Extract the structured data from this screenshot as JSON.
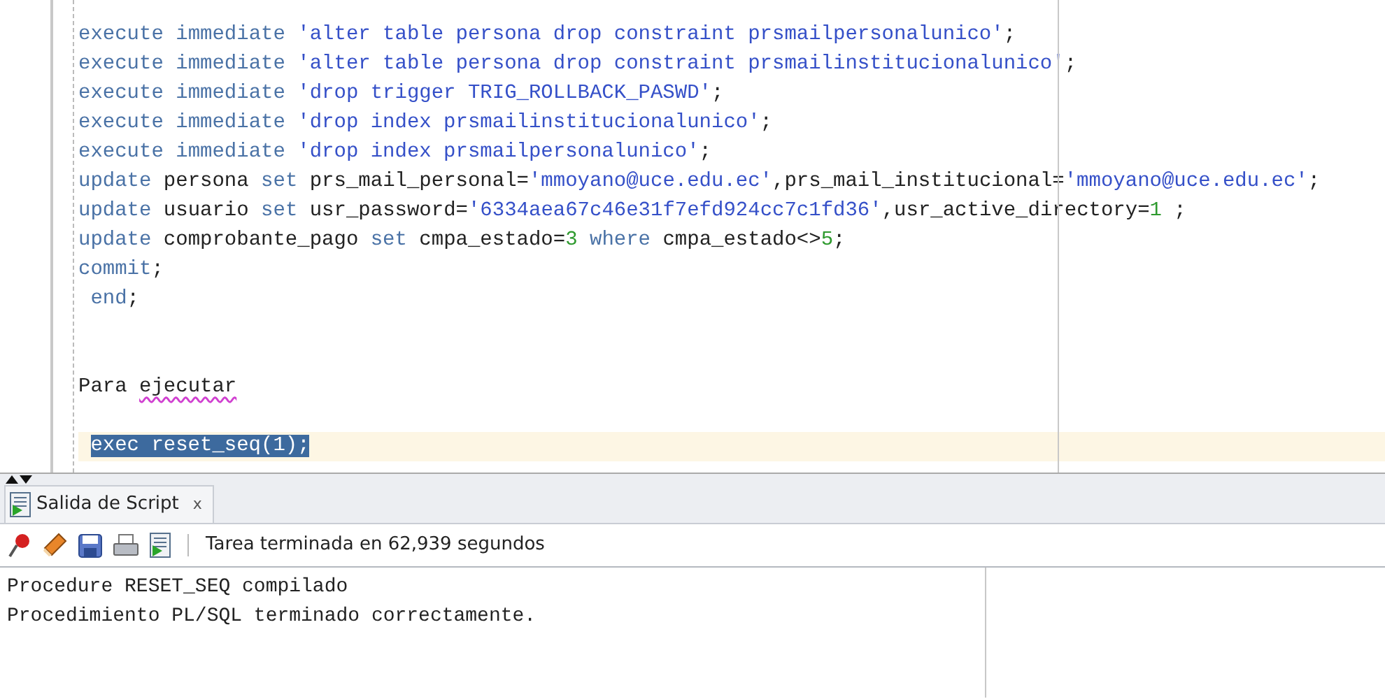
{
  "editor": {
    "lines": [
      {
        "current": false,
        "indent": false,
        "tokens": [
          {
            "text": "execute immediate ",
            "kind": "kw"
          },
          {
            "text": "'alter table persona drop constraint prsmailpersonalunico'",
            "kind": "str"
          },
          {
            "text": ";",
            "kind": "plain"
          }
        ]
      },
      {
        "current": false,
        "indent": false,
        "tokens": [
          {
            "text": "execute immediate ",
            "kind": "kw"
          },
          {
            "text": "'alter table persona drop constraint prsmailinstitucionalunico'",
            "kind": "str"
          },
          {
            "text": ";",
            "kind": "plain"
          }
        ]
      },
      {
        "current": false,
        "indent": false,
        "tokens": [
          {
            "text": "execute immediate ",
            "kind": "kw"
          },
          {
            "text": "'drop trigger TRIG_ROLLBACK_PASWD'",
            "kind": "str"
          },
          {
            "text": ";",
            "kind": "plain"
          }
        ]
      },
      {
        "current": false,
        "indent": false,
        "tokens": [
          {
            "text": "execute immediate ",
            "kind": "kw"
          },
          {
            "text": "'drop index prsmailinstitucionalunico'",
            "kind": "str"
          },
          {
            "text": ";",
            "kind": "plain"
          }
        ]
      },
      {
        "current": false,
        "indent": false,
        "tokens": [
          {
            "text": "execute immediate ",
            "kind": "kw"
          },
          {
            "text": "'drop index prsmailpersonalunico'",
            "kind": "str"
          },
          {
            "text": ";",
            "kind": "plain"
          }
        ]
      },
      {
        "current": false,
        "indent": false,
        "tokens": [
          {
            "text": "update",
            "kind": "kw"
          },
          {
            "text": " persona ",
            "kind": "plain"
          },
          {
            "text": "set",
            "kind": "kw"
          },
          {
            "text": " prs_mail_personal=",
            "kind": "plain"
          },
          {
            "text": "'mmoyano@uce.edu.ec'",
            "kind": "str"
          },
          {
            "text": ",prs_mail_institucional=",
            "kind": "plain"
          },
          {
            "text": "'mmoyano@uce.edu.ec'",
            "kind": "str"
          },
          {
            "text": ";",
            "kind": "plain"
          }
        ]
      },
      {
        "current": false,
        "indent": false,
        "tokens": [
          {
            "text": "update",
            "kind": "kw"
          },
          {
            "text": " usuario ",
            "kind": "plain"
          },
          {
            "text": "set",
            "kind": "kw"
          },
          {
            "text": " usr_password=",
            "kind": "plain"
          },
          {
            "text": "'6334aea67c46e31f7efd924cc7c1fd36'",
            "kind": "str"
          },
          {
            "text": ",usr_active_directory=",
            "kind": "plain"
          },
          {
            "text": "1",
            "kind": "num"
          },
          {
            "text": " ;",
            "kind": "plain"
          }
        ]
      },
      {
        "current": false,
        "indent": false,
        "tokens": [
          {
            "text": "update",
            "kind": "kw"
          },
          {
            "text": " comprobante_pago ",
            "kind": "plain"
          },
          {
            "text": "set",
            "kind": "kw"
          },
          {
            "text": " cmpa_estado=",
            "kind": "plain"
          },
          {
            "text": "3",
            "kind": "num"
          },
          {
            "text": " where",
            "kind": "kw"
          },
          {
            "text": " cmpa_estado<>",
            "kind": "plain"
          },
          {
            "text": "5",
            "kind": "num"
          },
          {
            "text": ";",
            "kind": "plain"
          }
        ]
      },
      {
        "current": false,
        "indent": false,
        "tokens": [
          {
            "text": "commit",
            "kind": "kw"
          },
          {
            "text": ";",
            "kind": "plain"
          }
        ]
      },
      {
        "current": false,
        "indent": true,
        "tokens": [
          {
            "text": "end",
            "kind": "kw"
          },
          {
            "text": ";",
            "kind": "plain"
          }
        ]
      },
      {
        "current": false,
        "indent": false,
        "tokens": [
          {
            "text": "Para ",
            "kind": "plain"
          },
          {
            "text": "ejecutar",
            "kind": "misspelled"
          }
        ]
      },
      {
        "current": true,
        "indent": true,
        "tokens": [
          {
            "text": "exec reset_seq(1);",
            "kind": "selection"
          }
        ]
      }
    ]
  },
  "output_panel": {
    "tabs": [
      {
        "label": "Salida de Script",
        "close": "x",
        "selected": true
      }
    ],
    "status": "Tarea terminada en 62,939 segundos",
    "lines": [
      "Procedure RESET_SEQ compilado",
      "Procedimiento PL/SQL terminado correctamente."
    ]
  }
}
